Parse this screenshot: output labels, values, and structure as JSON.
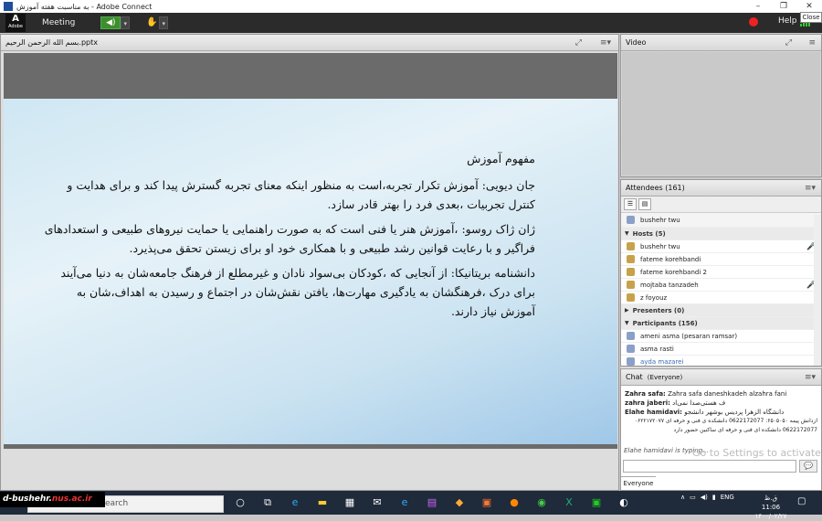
{
  "window": {
    "title": "به مناسبت هفته آموزش - Adobe Connect",
    "close_tip": "Close"
  },
  "menubar": {
    "logo": "A",
    "logo_sub": "Adobe",
    "meeting": "Meeting",
    "help": "Help"
  },
  "share_pod": {
    "title": "بسم الله الرحمن الرحیم.pptx"
  },
  "slide": {
    "heading": "مفهوم آموزش",
    "paragraphs": [
      "جان دیویی: آموزش تکرار تجربه،است به منظور اینکه معنای تجربه گسترش پیدا کند و برای هدایت و کنترل تجربیات ،بعدی فرد را بهتر قادر سازد.",
      "ژان ژاک روسو: ،آموزش هنر یا فنی است که به صورت راهنمایی یا حمایت نیروهای طبیعی و استعدادهای فراگیر و با رعایت قوانین رشد طبیعی و با همکاری خود او برای زیستن تحقق می‌پذیرد.",
      "دانشنامه بریتانیکا: از آنجایی که ،کودکان بی‌سواد نادان و غیرمطلع از فرهنگ جامعه‌شان به دنیا می‌آیند برای درک ،فرهنگشان به یادگیری مهارت‌ها، یافتن نقش‌شان در اجتماع و رسیدن به اهداف،شان به آموزش نیاز دارند."
    ]
  },
  "video_pod": {
    "title": "Video"
  },
  "attendees": {
    "title": "Attendees",
    "count": "(161)",
    "me": "bushehr twu",
    "hosts_label": "Hosts (5)",
    "hosts": [
      "bushehr twu",
      "fateme korehbandi",
      "fateme korehbandi 2",
      "mojtaba tanzadeh",
      "z foyouz"
    ],
    "presenters_label": "Presenters (0)",
    "participants_label": "Participants (156)",
    "participants": [
      "ameni asma (pesaran ramsar)",
      "asma rasti",
      "ayda mazarei"
    ]
  },
  "chat": {
    "title": "Chat",
    "audience": "(Everyone)",
    "messages": [
      {
        "who": "Zahra safa:",
        "text": "Zahra safa  daneshkadeh alzahra fani"
      },
      {
        "who": "zahra jaberi:",
        "text": "ف هستی‌صدا نمی‌اد"
      },
      {
        "who": "Elahe hamidavi:",
        "text": "دانشگاه الزهرا پردیس بوشهر دانشجو"
      },
      {
        "who": "",
        "text": "ازدانش پیمه ۶۵۰۵۰۵۰: 0622172077 دانشکده ی فنی و حرفه ای ۰۶۲۲۱۷۲۰۷۷"
      },
      {
        "who": "",
        "text": "0622172077 دانشکده ای فنی و حرفه ای ساکنین حضور دارد"
      }
    ],
    "typing": "Elahe hamidavi is typing...",
    "watermark": "Go to Settings to activate Windows.",
    "tab": "Everyone"
  },
  "taskbar": {
    "brand_a": "d-bushehr.",
    "brand_b": "nus.ac.ir",
    "search": "earch",
    "lang": "ENG",
    "time": "ق.ظ 11:06",
    "date": "۱۴۰۰/۰۲/۲۷"
  }
}
